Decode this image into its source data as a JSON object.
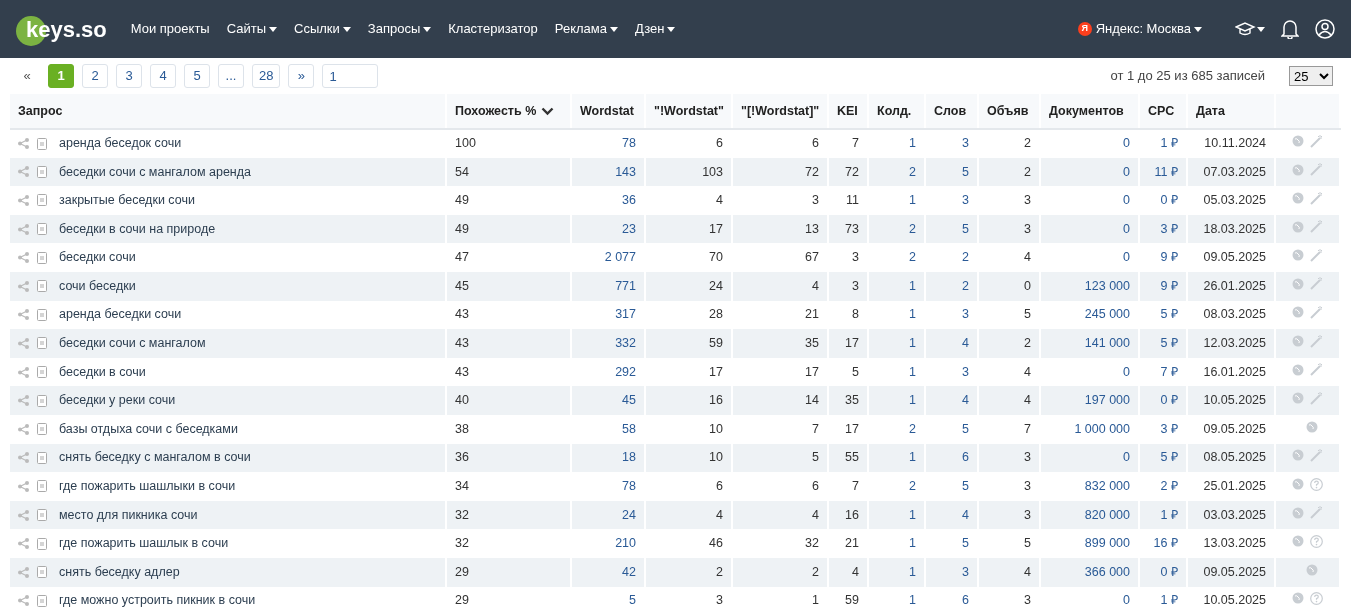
{
  "navbar": {
    "logo": "keys.so",
    "menu": [
      {
        "label": "Мои проекты",
        "dropdown": false
      },
      {
        "label": "Сайты",
        "dropdown": true
      },
      {
        "label": "Ссылки",
        "dropdown": true
      },
      {
        "label": "Запросы",
        "dropdown": true
      },
      {
        "label": "Кластеризатор",
        "dropdown": false
      },
      {
        "label": "Реклама",
        "dropdown": true
      },
      {
        "label": "Дзен",
        "dropdown": true
      }
    ],
    "region": {
      "badge": "Я",
      "label": "Яндекс: Москва"
    }
  },
  "pagination": {
    "pages": [
      {
        "label": "«",
        "selected": false
      },
      {
        "label": "1",
        "selected": true
      },
      {
        "label": "2",
        "selected": false
      },
      {
        "label": "3",
        "selected": false
      },
      {
        "label": "4",
        "selected": false
      },
      {
        "label": "5",
        "selected": false
      },
      {
        "label": "...",
        "selected": false
      },
      {
        "label": "28",
        "selected": false
      },
      {
        "label": "»",
        "selected": false
      }
    ],
    "page_input": "1"
  },
  "records_info": "от 1 до 25 из 685 записей",
  "page_size": "25",
  "table": {
    "columns": [
      {
        "label": "Запрос",
        "sorted": false
      },
      {
        "label": "Похожесть %",
        "sorted": true
      },
      {
        "label": "Wordstat",
        "sorted": false
      },
      {
        "label": "\"!Wordstat\"",
        "sorted": false
      },
      {
        "label": "\"[!Wordstat]\"",
        "sorted": false
      },
      {
        "label": "KEI",
        "sorted": false
      },
      {
        "label": "Колд.",
        "sorted": false
      },
      {
        "label": "Слов",
        "sorted": false
      },
      {
        "label": "Объяв",
        "sorted": false
      },
      {
        "label": "Документов",
        "sorted": false
      },
      {
        "label": "CPC",
        "sorted": false
      },
      {
        "label": "Дата",
        "sorted": false
      }
    ],
    "rows": [
      {
        "cells": [
          "аренда беседок сочи",
          "100",
          "78",
          "6",
          "6",
          "7",
          "1",
          "3",
          "2",
          "0",
          "1 ₽",
          "10.11.2024"
        ],
        "kind": "wand"
      },
      {
        "cells": [
          "беседки сочи с мангалом аренда",
          "54",
          "143",
          "103",
          "72",
          "72",
          "2",
          "5",
          "2",
          "0",
          "11 ₽",
          "07.03.2025"
        ],
        "kind": "wand"
      },
      {
        "cells": [
          "закрытые беседки сочи",
          "49",
          "36",
          "4",
          "3",
          "11",
          "1",
          "3",
          "3",
          "0",
          "0 ₽",
          "05.03.2025"
        ],
        "kind": "wand"
      },
      {
        "cells": [
          "беседки в сочи на природе",
          "49",
          "23",
          "17",
          "13",
          "73",
          "2",
          "5",
          "3",
          "0",
          "3 ₽",
          "18.03.2025"
        ],
        "kind": "wand"
      },
      {
        "cells": [
          "беседки сочи",
          "47",
          "2 077",
          "70",
          "67",
          "3",
          "2",
          "2",
          "4",
          "0",
          "9 ₽",
          "09.05.2025"
        ],
        "kind": "wand"
      },
      {
        "cells": [
          "сочи беседки",
          "45",
          "771",
          "24",
          "4",
          "3",
          "1",
          "2",
          "0",
          "123 000",
          "9 ₽",
          "26.01.2025"
        ],
        "kind": "wand"
      },
      {
        "cells": [
          "аренда беседки сочи",
          "43",
          "317",
          "28",
          "21",
          "8",
          "1",
          "3",
          "5",
          "245 000",
          "5 ₽",
          "08.03.2025"
        ],
        "kind": "wand"
      },
      {
        "cells": [
          "беседки сочи с мангалом",
          "43",
          "332",
          "59",
          "35",
          "17",
          "1",
          "4",
          "2",
          "141 000",
          "5 ₽",
          "12.03.2025"
        ],
        "kind": "wand"
      },
      {
        "cells": [
          "беседки в сочи",
          "43",
          "292",
          "17",
          "17",
          "5",
          "1",
          "3",
          "4",
          "0",
          "7 ₽",
          "16.01.2025"
        ],
        "kind": "wand"
      },
      {
        "cells": [
          "беседки у реки сочи",
          "40",
          "45",
          "16",
          "14",
          "35",
          "1",
          "4",
          "4",
          "197 000",
          "0 ₽",
          "10.05.2025"
        ],
        "kind": "wand"
      },
      {
        "cells": [
          "базы отдыха сочи с беседками",
          "38",
          "58",
          "10",
          "7",
          "17",
          "2",
          "5",
          "7",
          "1 000 000",
          "3 ₽",
          "09.05.2025"
        ],
        "kind": "plain"
      },
      {
        "cells": [
          "снять беседку с мангалом в сочи",
          "36",
          "18",
          "10",
          "5",
          "55",
          "1",
          "6",
          "3",
          "0",
          "5 ₽",
          "08.05.2025"
        ],
        "kind": "wand"
      },
      {
        "cells": [
          "где пожарить шашлыки в сочи",
          "34",
          "78",
          "6",
          "6",
          "7",
          "2",
          "5",
          "3",
          "832 000",
          "2 ₽",
          "25.01.2025"
        ],
        "kind": "question"
      },
      {
        "cells": [
          "место для пикника сочи",
          "32",
          "24",
          "4",
          "4",
          "16",
          "1",
          "4",
          "3",
          "820 000",
          "1 ₽",
          "03.03.2025"
        ],
        "kind": "wand"
      },
      {
        "cells": [
          "где пожарить шашлык в сочи",
          "32",
          "210",
          "46",
          "32",
          "21",
          "1",
          "5",
          "5",
          "899 000",
          "16 ₽",
          "13.03.2025"
        ],
        "kind": "question"
      },
      {
        "cells": [
          "снять беседку адлер",
          "29",
          "42",
          "2",
          "2",
          "4",
          "1",
          "3",
          "4",
          "366 000",
          "0 ₽",
          "09.05.2025"
        ],
        "kind": "plain"
      },
      {
        "cells": [
          "где можно устроить пикник в сочи",
          "29",
          "5",
          "3",
          "1",
          "59",
          "1",
          "6",
          "3",
          "0",
          "1 ₽",
          "10.05.2025"
        ],
        "kind": "question"
      }
    ]
  }
}
